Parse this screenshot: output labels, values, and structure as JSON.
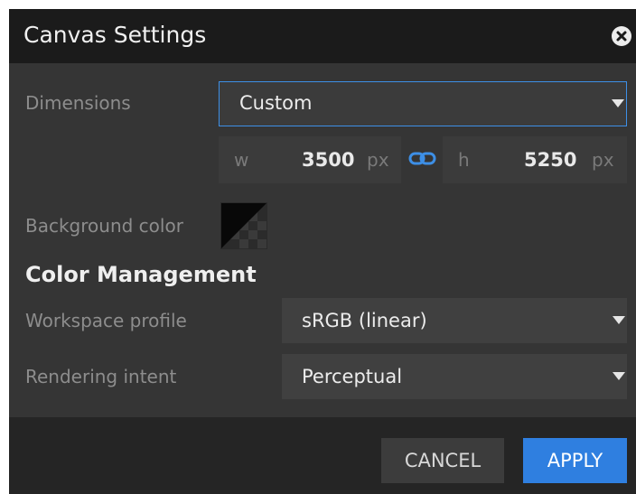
{
  "dialog": {
    "title": "Canvas Settings",
    "close_icon": "close-circle-icon"
  },
  "dimensions": {
    "label": "Dimensions",
    "preset_value": "Custom",
    "width": {
      "letter": "w",
      "value": "3500",
      "unit": "px"
    },
    "height": {
      "letter": "h",
      "value": "5250",
      "unit": "px"
    },
    "link_icon": "chain-link-icon"
  },
  "background": {
    "label": "Background color",
    "swatch": "transparent-checker-black-swatch"
  },
  "color_management": {
    "heading": "Color Management",
    "workspace_profile": {
      "label": "Workspace profile",
      "value": "sRGB (linear)"
    },
    "rendering_intent": {
      "label": "Rendering intent",
      "value": "Perceptual"
    }
  },
  "footer": {
    "cancel_label": "CANCEL",
    "apply_label": "APPLY"
  },
  "colors": {
    "accent": "#2f7fe0",
    "dialog_bg": "#353535",
    "titlebar_bg": "#1b1b1b"
  }
}
